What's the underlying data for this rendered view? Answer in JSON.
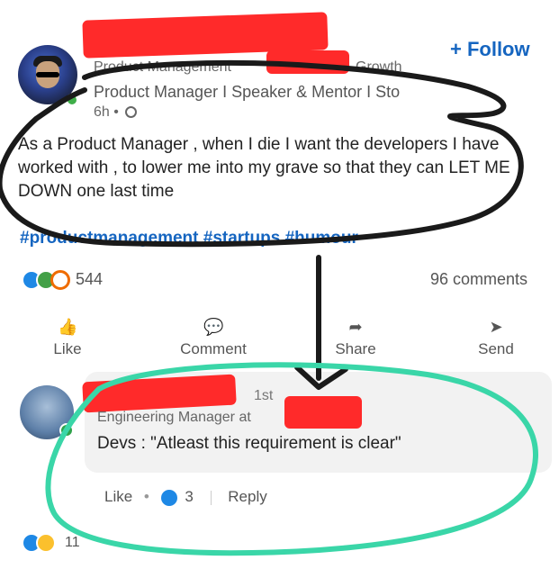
{
  "post": {
    "author_title_line": "Product Manager I Speaker & Mentor I Sto",
    "top_partial_label": "Product Management",
    "top_partial_right": "Growth",
    "time_ago": "6h •",
    "follow_label": "+ Follow",
    "body": "As a Product Manager , when I die I want the developers I have worked with , to lower me into my grave so that they can LET ME DOWN one last time",
    "hashtags": "#productmanagement #startups #humour",
    "reaction_count": "544",
    "comments_count": "96 comments"
  },
  "actions": [
    {
      "label": "Like",
      "icon": "like-icon"
    },
    {
      "label": "Comment",
      "icon": "comment-icon"
    },
    {
      "label": "Share",
      "icon": "share-icon"
    },
    {
      "label": "Send",
      "icon": "send-icon"
    }
  ],
  "comment": {
    "connection_degree": "1st",
    "headline": "Engineering Manager at",
    "text": "Devs : \"Atleast this requirement is clear\"",
    "like_label": "Like",
    "reaction_count": "3",
    "reply_label": "Reply"
  },
  "footer": {
    "reaction_count": "11"
  },
  "colors": {
    "link_blue": "#1565c0",
    "redaction_red": "#ff2a2a",
    "marker_black": "#1a1a1a",
    "highlight_green": "#3ad6a8"
  }
}
